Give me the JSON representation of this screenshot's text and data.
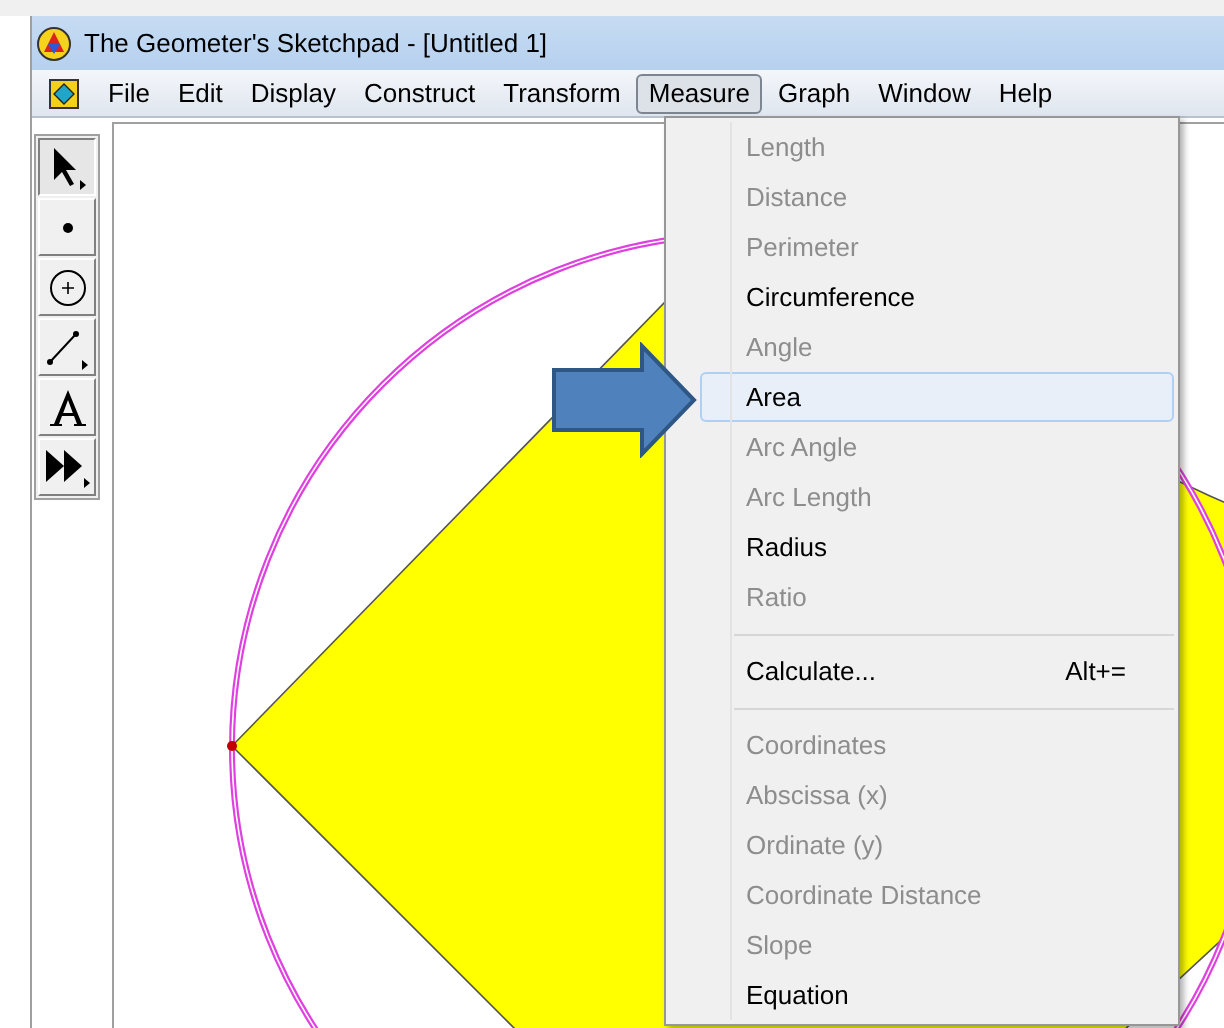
{
  "window": {
    "title": "The Geometer's Sketchpad - [Untitled 1]"
  },
  "menu_bar": [
    {
      "label": "File",
      "selected": false
    },
    {
      "label": "Edit",
      "selected": false
    },
    {
      "label": "Display",
      "selected": false
    },
    {
      "label": "Construct",
      "selected": false
    },
    {
      "label": "Transform",
      "selected": false
    },
    {
      "label": "Measure",
      "selected": true
    },
    {
      "label": "Graph",
      "selected": false
    },
    {
      "label": "Window",
      "selected": false
    },
    {
      "label": "Help",
      "selected": false
    }
  ],
  "tools": [
    {
      "kind": "arrow",
      "selected": true
    },
    {
      "kind": "point",
      "selected": false
    },
    {
      "kind": "compass",
      "selected": false
    },
    {
      "kind": "line",
      "selected": false
    },
    {
      "kind": "text",
      "selected": false
    },
    {
      "kind": "custom",
      "selected": false
    }
  ],
  "measure_menu": [
    {
      "kind": "item",
      "label": "Length",
      "disabled": true,
      "selected": false
    },
    {
      "kind": "item",
      "label": "Distance",
      "disabled": true,
      "selected": false
    },
    {
      "kind": "item",
      "label": "Perimeter",
      "disabled": true,
      "selected": false
    },
    {
      "kind": "item",
      "label": "Circumference",
      "disabled": false,
      "selected": false
    },
    {
      "kind": "item",
      "label": "Angle",
      "disabled": true,
      "selected": false
    },
    {
      "kind": "item",
      "label": "Area",
      "disabled": false,
      "selected": true
    },
    {
      "kind": "item",
      "label": "Arc Angle",
      "disabled": true,
      "selected": false
    },
    {
      "kind": "item",
      "label": "Arc Length",
      "disabled": true,
      "selected": false
    },
    {
      "kind": "item",
      "label": "Radius",
      "disabled": false,
      "selected": false
    },
    {
      "kind": "item",
      "label": "Ratio",
      "disabled": true,
      "selected": false
    },
    {
      "kind": "separator"
    },
    {
      "kind": "item",
      "label": "Calculate...",
      "shortcut": "Alt+=",
      "disabled": false,
      "selected": false
    },
    {
      "kind": "separator"
    },
    {
      "kind": "item",
      "label": "Coordinates",
      "disabled": true,
      "selected": false
    },
    {
      "kind": "item",
      "label": "Abscissa (x)",
      "disabled": true,
      "selected": false
    },
    {
      "kind": "item",
      "label": "Ordinate (y)",
      "disabled": true,
      "selected": false
    },
    {
      "kind": "item",
      "label": "Coordinate Distance",
      "disabled": true,
      "selected": false
    },
    {
      "kind": "item",
      "label": "Slope",
      "disabled": true,
      "selected": false
    },
    {
      "kind": "item",
      "label": "Equation",
      "disabled": false,
      "selected": false
    }
  ]
}
